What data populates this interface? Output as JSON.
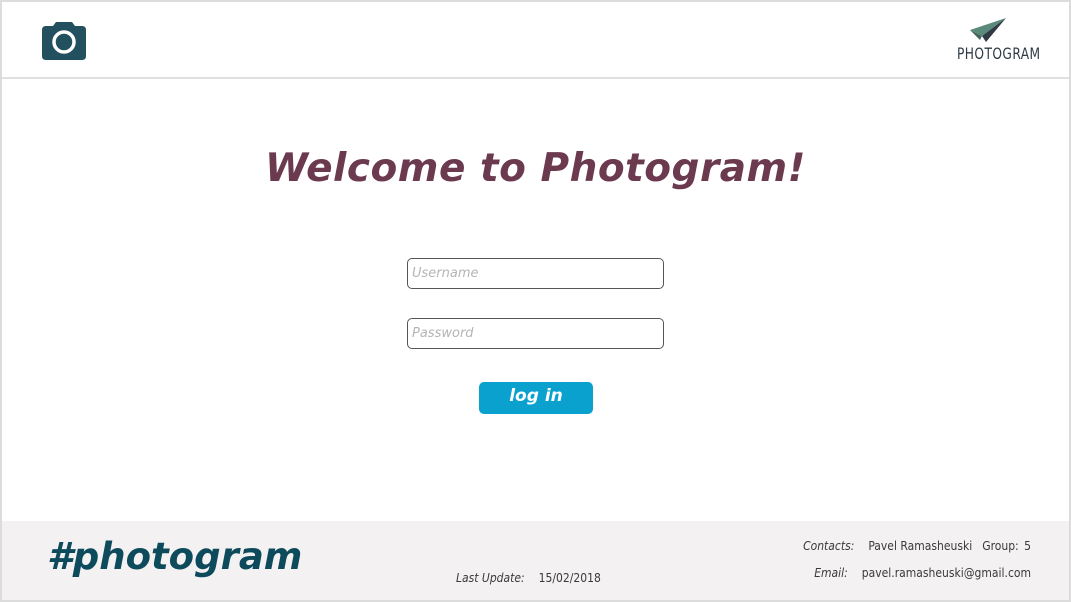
{
  "header": {
    "camera_icon": "camera-icon",
    "brand_name": "PHOTOGRAM",
    "brand_icon": "paper-plane-icon",
    "brand_color": "#2f3a44",
    "camera_color": "#23505f"
  },
  "main": {
    "title": "Welcome to Photogram!",
    "title_color": "#6b3a4f",
    "username_placeholder": "Username",
    "username_value": "",
    "password_placeholder": "Password",
    "password_value": "",
    "login_label": "log in",
    "login_color": "#0aa1cf"
  },
  "footer": {
    "hashtag": "#photogram",
    "hashtag_color": "#0d4a5c",
    "last_update_label": "Last Update:",
    "last_update_value": "15/02/2018",
    "contacts_label": "Contacts:",
    "contacts_name": "Pavel Ramasheuski",
    "group_label": "Group:",
    "group_value": "5",
    "email_label": "Email:",
    "email_value": "pavel.ramasheuski@gmail.com"
  }
}
